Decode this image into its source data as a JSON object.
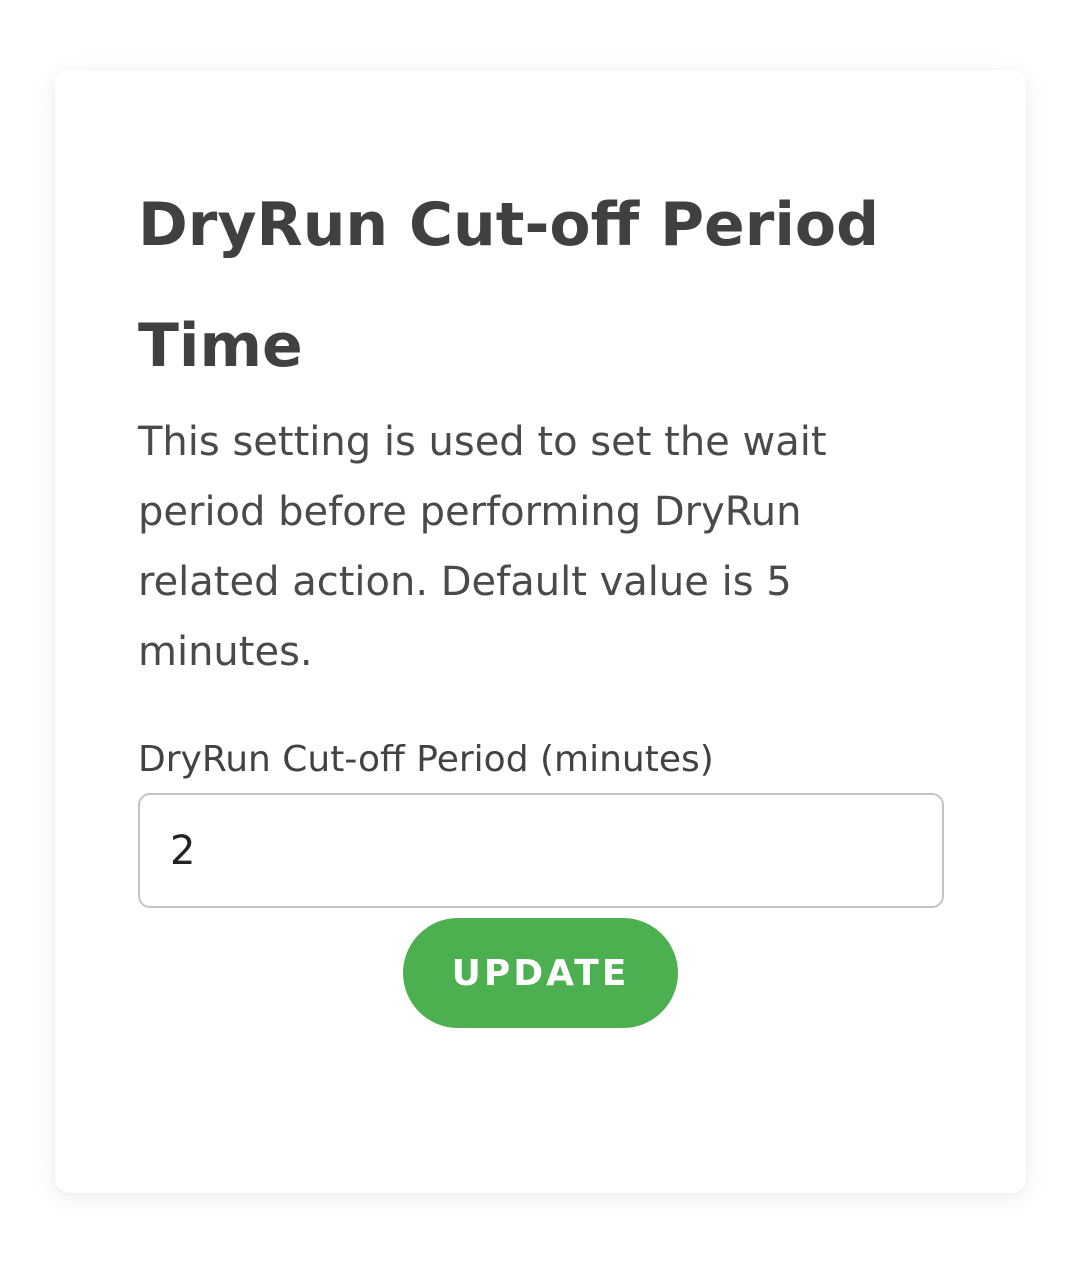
{
  "card": {
    "title": "DryRun Cut-off Period Time",
    "description": "This setting is used to set the wait period before performing DryRun related action. Default value is 5 minutes.",
    "field": {
      "label": "DryRun Cut-off Period (minutes)",
      "value": "2"
    },
    "update_label": "UPDATE"
  },
  "colors": {
    "accent": "#4caf50",
    "title_text": "#404040",
    "body_text": "#4a4a4a",
    "input_border": "#c4c4c4"
  }
}
